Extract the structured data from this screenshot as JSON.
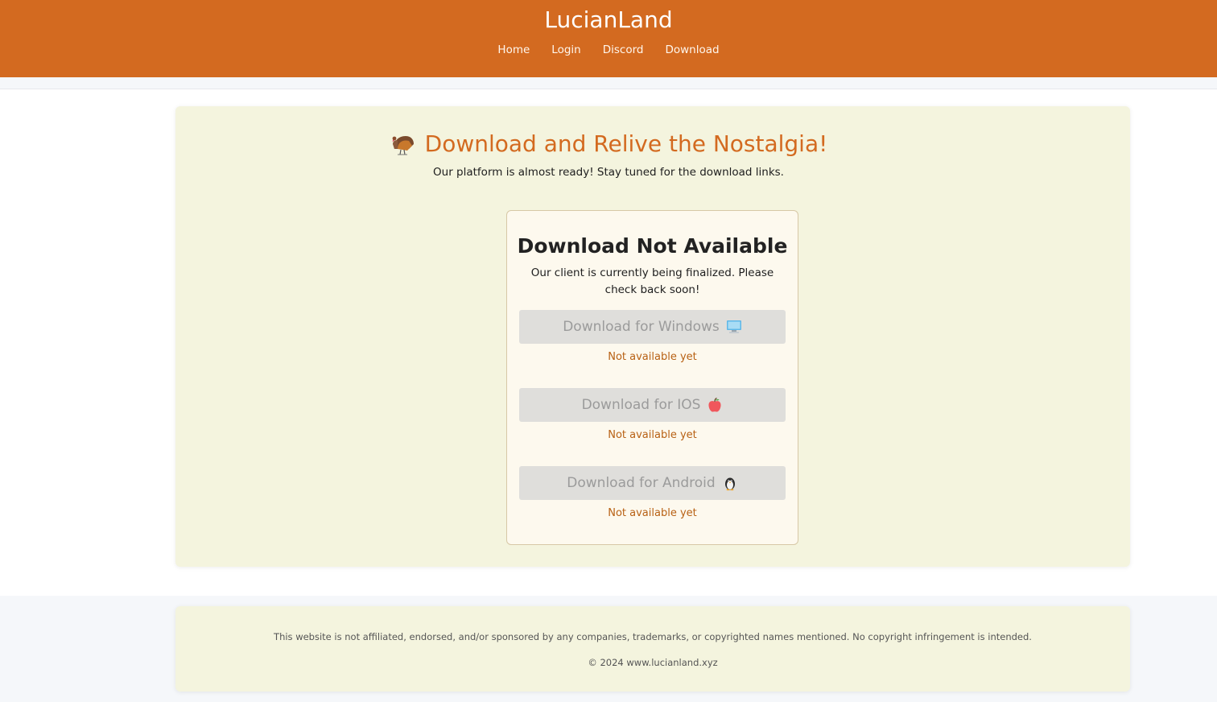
{
  "header": {
    "brand": "LucianLand",
    "nav": [
      {
        "label": "Home"
      },
      {
        "label": "Login"
      },
      {
        "label": "Discord"
      },
      {
        "label": "Download"
      }
    ]
  },
  "hero": {
    "icon": "turkey-icon",
    "title": "Download and Relive the Nostalgia!",
    "subtitle": "Our platform is almost ready! Stay tuned for the download links."
  },
  "download_card": {
    "title": "Download Not Available",
    "description": "Our client is currently being finalized. Please check back soon!",
    "options": [
      {
        "label": "Download for Windows",
        "icon": "computer-icon",
        "status": "Not available yet"
      },
      {
        "label": "Download for IOS",
        "icon": "apple-icon",
        "status": "Not available yet"
      },
      {
        "label": "Download for Android",
        "icon": "penguin-icon",
        "status": "Not available yet"
      }
    ]
  },
  "footer": {
    "disclaimer": "This website is not affiliated, endorsed, and/or sponsored by any companies, trademarks, or copyrighted names mentioned. No copyright infringement is intended.",
    "copyright": "© 2024 www.lucianland.xyz"
  },
  "colors": {
    "brand": "#d36a20",
    "card_background": "#f4f4de",
    "status": "#b86114",
    "disabled_button": "#dfdedb"
  }
}
